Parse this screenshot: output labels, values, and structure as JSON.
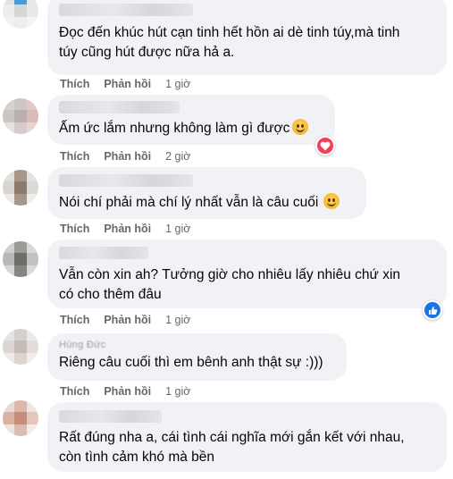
{
  "actions": {
    "like_label": "Thích",
    "reply_label": "Phản hồi"
  },
  "colors": {
    "bubble_bg": "#f0f2f5",
    "action_text": "#65676b",
    "love_reaction": "#f33e58",
    "like_reaction": "#1b74e4"
  },
  "comments": [
    {
      "text": "Đọc đến khúc hút cạn tinh hết hồn ai dè tinh túy,mà tinh\ntúy cũng hút được nữa hả a.",
      "time": "1 giờ"
    },
    {
      "text": "Ấm ức lắm nhưng không làm gì được",
      "time": "2 giờ",
      "inline_emoji": "laughing-crying-emoji",
      "reaction": "haha-reaction-icon"
    },
    {
      "text": "Nói chí phải mà chí lý nhất vẫn là câu cuối",
      "time": "1 giờ",
      "inline_emoji": "smiling-face-emoji"
    },
    {
      "text": "Vẫn còn xin ah? Tưởng giờ cho nhiêu lấy nhiêu chứ xin\ncó cho thêm đâu",
      "time": "1 giờ",
      "reaction": "like-reaction-icon"
    },
    {
      "name_partial": "Hùng Đức",
      "text": "Riêng câu cuối thì em bênh anh thật sự :)))",
      "time": "1 giờ"
    },
    {
      "text": "Rất đúng nha a, cái tình cái nghĩa mới gắn kết với nhau,\ncòn tình cảm khó mà bền"
    }
  ]
}
